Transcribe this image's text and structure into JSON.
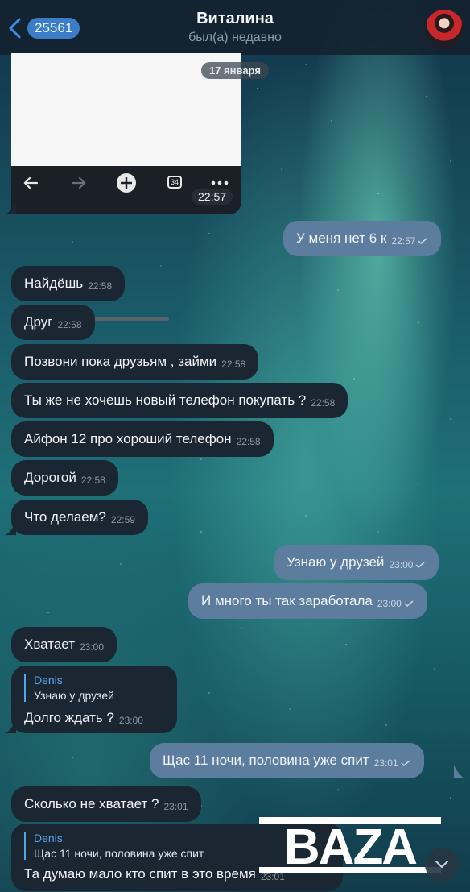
{
  "header": {
    "back_count": "25561",
    "title": "Виталина",
    "status": "был(а) недавно"
  },
  "date_separator": "17 января",
  "media": {
    "time": "22:57",
    "tabs_count": "34"
  },
  "messages": [
    {
      "side": "out",
      "text": "У меня нет 6 к",
      "time": "22:57"
    },
    {
      "side": "in",
      "text": "Найдёшь",
      "time": "22:58"
    },
    {
      "side": "in",
      "text": "Друг",
      "time": "22:58"
    },
    {
      "side": "in",
      "text": "Позвони пока друзьям , займи",
      "time": "22:58"
    },
    {
      "side": "in",
      "text": "Ты же не хочешь новый телефон покупать ?",
      "time": "22:58"
    },
    {
      "side": "in",
      "text": "Айфон 12 про хороший телефон",
      "time": "22:58"
    },
    {
      "side": "in",
      "text": "Дорогой",
      "time": "22:58"
    },
    {
      "side": "in",
      "text": "Что делаем?",
      "time": "22:59"
    },
    {
      "side": "out",
      "text": "Узнаю у друзей",
      "time": "23:00"
    },
    {
      "side": "out",
      "text": "И много ты так заработала",
      "time": "23:00"
    },
    {
      "side": "in",
      "text": "Хватает",
      "time": "23:00"
    },
    {
      "side": "in",
      "reply_author": "Denis",
      "reply_text": "Узнаю у друзей",
      "text": "Долго ждать ?",
      "time": "23:00"
    },
    {
      "side": "out",
      "text": "Щас 11 ночи, половина уже спит",
      "time": "23:01"
    },
    {
      "side": "in",
      "text": "Сколько не хватает ?",
      "time": "23:01"
    },
    {
      "side": "in",
      "reply_author": "Denis",
      "reply_text": "Щас 11 ночи, половина уже спит",
      "text": "Та думаю мало кто спит в это время",
      "time": "23:01"
    }
  ],
  "watermark": "BAZA",
  "colors": {
    "incoming_bubble": "#1b2633",
    "outgoing_bubble": "#5d7d9e",
    "accent": "#3b7ec7",
    "reply_accent": "#5aa3e8"
  }
}
